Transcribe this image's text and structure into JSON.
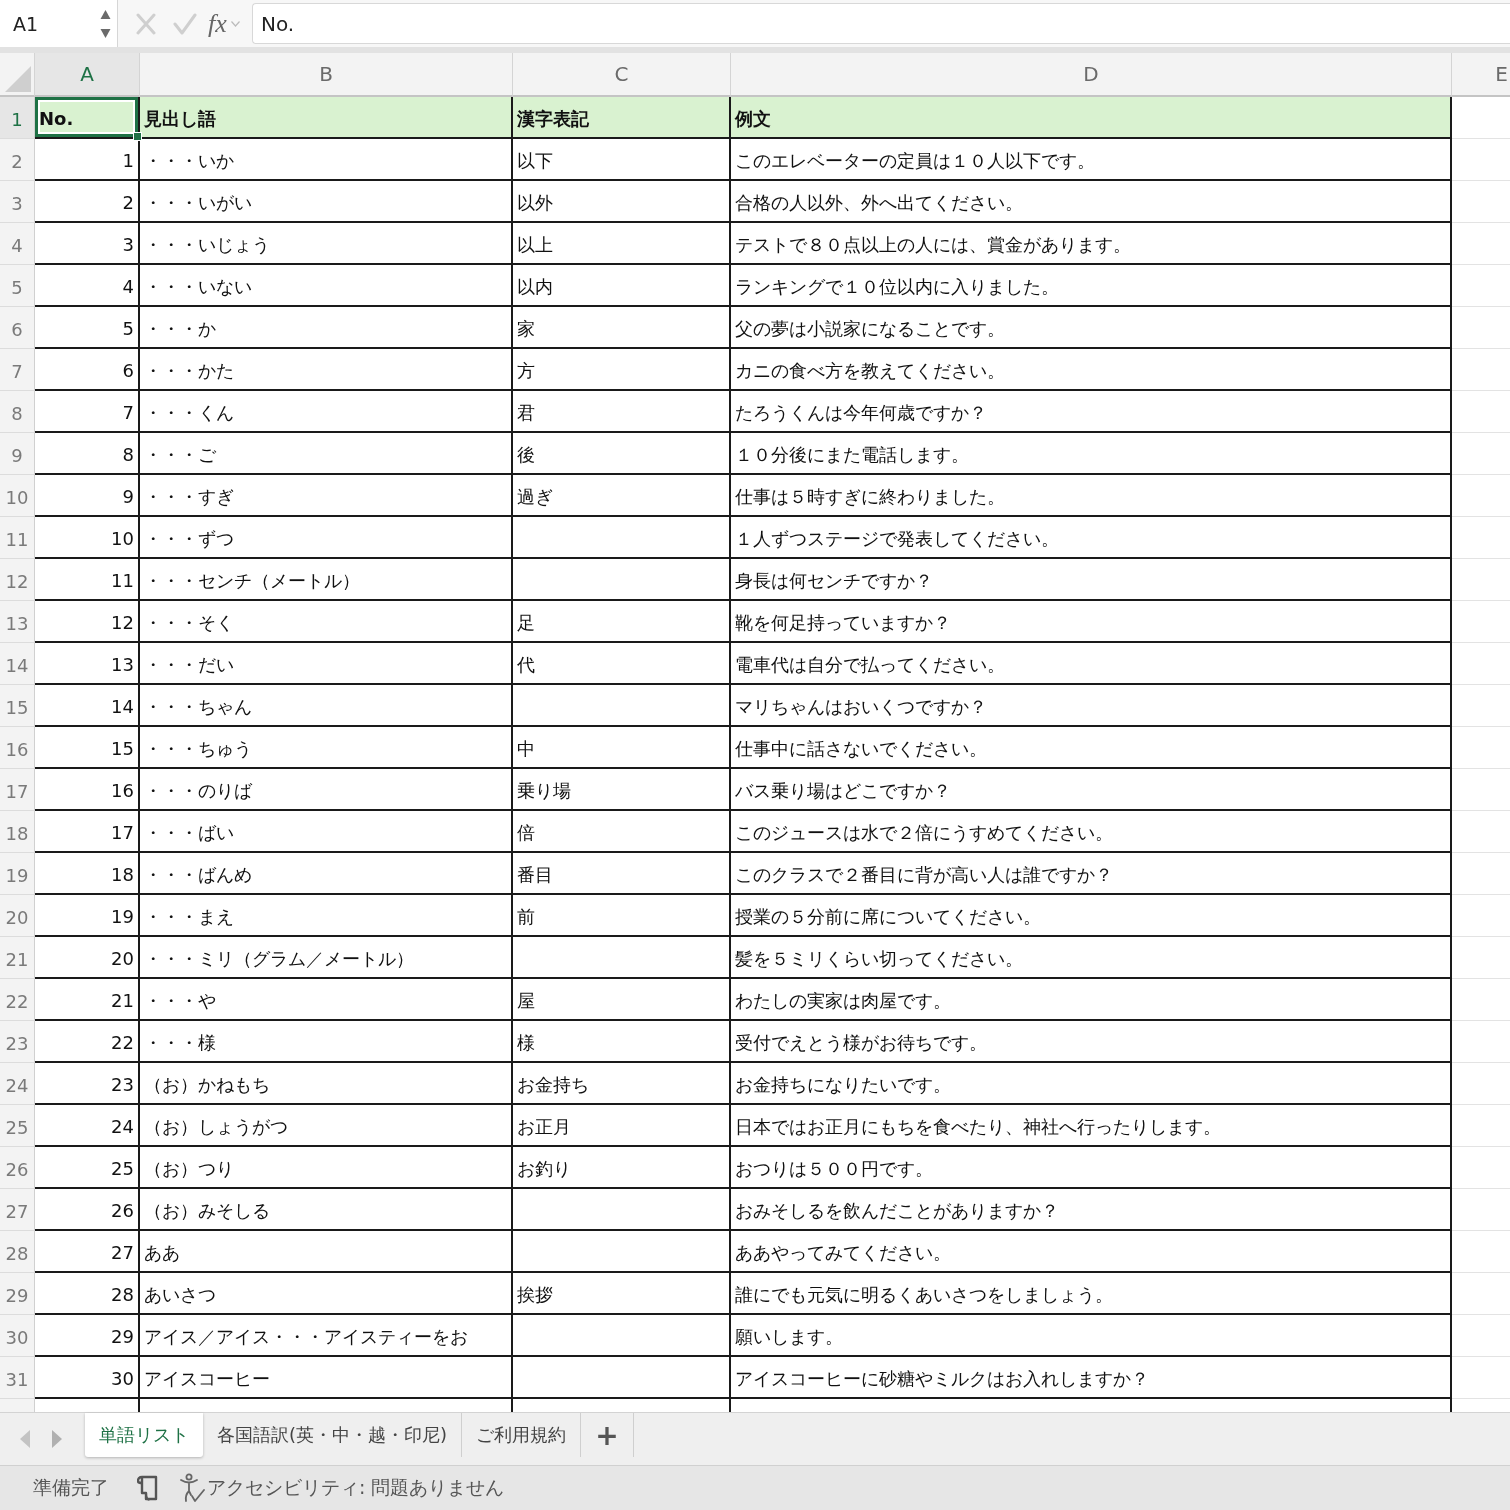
{
  "formula_bar": {
    "name_box": "A1",
    "function_label": "fx",
    "formula": "No."
  },
  "columns": [
    {
      "label": "A",
      "selected": true
    },
    {
      "label": "B",
      "selected": false
    },
    {
      "label": "C",
      "selected": false
    },
    {
      "label": "D",
      "selected": false
    },
    {
      "label": "E",
      "selected": false
    }
  ],
  "sheet": {
    "rows": [
      {
        "row": "1",
        "kind": "header",
        "selected": true,
        "no": "No.",
        "headword": "見出し語",
        "kanji": "漢字表記",
        "example": "例文"
      },
      {
        "row": "2",
        "kind": "data",
        "selected": false,
        "no": "1",
        "headword": "・・・いか",
        "kanji": "以下",
        "example": "このエレベーターの定員は１０人以下です。"
      },
      {
        "row": "3",
        "kind": "data",
        "selected": false,
        "no": "2",
        "headword": "・・・いがい",
        "kanji": "以外",
        "example": "合格の人以外、外へ出てください。"
      },
      {
        "row": "4",
        "kind": "data",
        "selected": false,
        "no": "3",
        "headword": "・・・いじょう",
        "kanji": "以上",
        "example": "テストで８０点以上の人には、賞金があります。"
      },
      {
        "row": "5",
        "kind": "data",
        "selected": false,
        "no": "4",
        "headword": "・・・いない",
        "kanji": "以内",
        "example": "ランキングで１０位以内に入りました。"
      },
      {
        "row": "6",
        "kind": "data",
        "selected": false,
        "no": "5",
        "headword": "・・・か",
        "kanji": "家",
        "example": "父の夢は小説家になることです。"
      },
      {
        "row": "7",
        "kind": "data",
        "selected": false,
        "no": "6",
        "headword": "・・・かた",
        "kanji": "方",
        "example": "カニの食べ方を教えてください。"
      },
      {
        "row": "8",
        "kind": "data",
        "selected": false,
        "no": "7",
        "headword": "・・・くん",
        "kanji": "君",
        "example": "たろうくんは今年何歳ですか？"
      },
      {
        "row": "9",
        "kind": "data",
        "selected": false,
        "no": "8",
        "headword": "・・・ご",
        "kanji": "後",
        "example": "１０分後にまた電話します。"
      },
      {
        "row": "10",
        "kind": "data",
        "selected": false,
        "no": "9",
        "headword": "・・・すぎ",
        "kanji": "過ぎ",
        "example": "仕事は５時すぎに終わりました。"
      },
      {
        "row": "11",
        "kind": "data",
        "selected": false,
        "no": "10",
        "headword": "・・・ずつ",
        "example": "１人ずつステージで発表してください。"
      },
      {
        "row": "12",
        "kind": "data",
        "selected": false,
        "no": "11",
        "headword": "・・・センチ（メートル）",
        "example": "身長は何センチですか？"
      },
      {
        "row": "13",
        "kind": "data",
        "selected": false,
        "no": "12",
        "headword": "・・・そく",
        "kanji": "足",
        "example": "靴を何足持っていますか？"
      },
      {
        "row": "14",
        "kind": "data",
        "selected": false,
        "no": "13",
        "headword": "・・・だい",
        "kanji": "代",
        "example": "電車代は自分で払ってください。"
      },
      {
        "row": "15",
        "kind": "data",
        "selected": false,
        "no": "14",
        "headword": "・・・ちゃん",
        "example": "マリちゃんはおいくつですか？"
      },
      {
        "row": "16",
        "kind": "data",
        "selected": false,
        "no": "15",
        "headword": "・・・ちゅう",
        "kanji": "中",
        "example": "仕事中に話さないでください。"
      },
      {
        "row": "17",
        "kind": "data",
        "selected": false,
        "no": "16",
        "headword": "・・・のりば",
        "kanji": "乗り場",
        "example": "バス乗り場はどこですか？"
      },
      {
        "row": "18",
        "kind": "data",
        "selected": false,
        "no": "17",
        "headword": "・・・ばい",
        "kanji": "倍",
        "example": "このジュースは水で２倍にうすめてください。"
      },
      {
        "row": "19",
        "kind": "data",
        "selected": false,
        "no": "18",
        "headword": "・・・ばんめ",
        "kanji": "番目",
        "example": "このクラスで２番目に背が高い人は誰ですか？"
      },
      {
        "row": "20",
        "kind": "data",
        "selected": false,
        "no": "19",
        "headword": "・・・まえ",
        "kanji": "前",
        "example": "授業の５分前に席についてください。"
      },
      {
        "row": "21",
        "kind": "data",
        "selected": false,
        "no": "20",
        "headword": "・・・ミリ（グラム／メートル）",
        "example": "髪を５ミリくらい切ってください。"
      },
      {
        "row": "22",
        "kind": "data",
        "selected": false,
        "no": "21",
        "headword": "・・・や",
        "kanji": "屋",
        "example": "わたしの実家は肉屋です。"
      },
      {
        "row": "23",
        "kind": "data",
        "selected": false,
        "no": "22",
        "headword": "・・・様",
        "kanji": "様",
        "example": "受付でえとう様がお待ちです。"
      },
      {
        "row": "24",
        "kind": "data",
        "selected": false,
        "no": "23",
        "headword": "（お）かねもち",
        "kanji": "お金持ち",
        "example": "お金持ちになりたいです。"
      },
      {
        "row": "25",
        "kind": "data",
        "selected": false,
        "no": "24",
        "headword": "（お）しょうがつ",
        "kanji": "お正月",
        "example": "日本ではお正月にもちを食べたり、神社へ行ったりします。"
      },
      {
        "row": "26",
        "kind": "data",
        "selected": false,
        "no": "25",
        "headword": "（お）つり",
        "kanji": "お釣り",
        "example": "おつりは５００円です。"
      },
      {
        "row": "27",
        "kind": "data",
        "selected": false,
        "no": "26",
        "headword": "（お）みそしる",
        "example": "おみそしるを飲んだことがありますか？"
      },
      {
        "row": "28",
        "kind": "data",
        "selected": false,
        "no": "27",
        "headword": "ああ",
        "example": "ああやってみてください。"
      },
      {
        "row": "29",
        "kind": "data",
        "selected": false,
        "no": "28",
        "headword": "あいさつ",
        "kanji": "挨拶",
        "example": "誰にでも元気に明るくあいさつをしましょう。"
      },
      {
        "row": "30",
        "kind": "data",
        "selected": false,
        "no": "29",
        "headword": "アイス／アイス・・・アイスティーをお",
        "example": "願いします。"
      },
      {
        "row": "31",
        "kind": "data",
        "selected": false,
        "no": "30",
        "headword": "アイスコーヒー",
        "example": "アイスコーヒーに砂糖やミルクはお入れしますか？"
      }
    ]
  },
  "sheet_tabs": [
    {
      "label": "単語リスト",
      "selected": true
    },
    {
      "label": "各国語訳(英・中・越・印尼)",
      "selected": false
    },
    {
      "label": "ご利用規約",
      "selected": false
    }
  ],
  "add_sheet": "+",
  "status_bar": {
    "status": "準備完了",
    "accessibility": "アクセシビリティ: 問題ありません"
  }
}
